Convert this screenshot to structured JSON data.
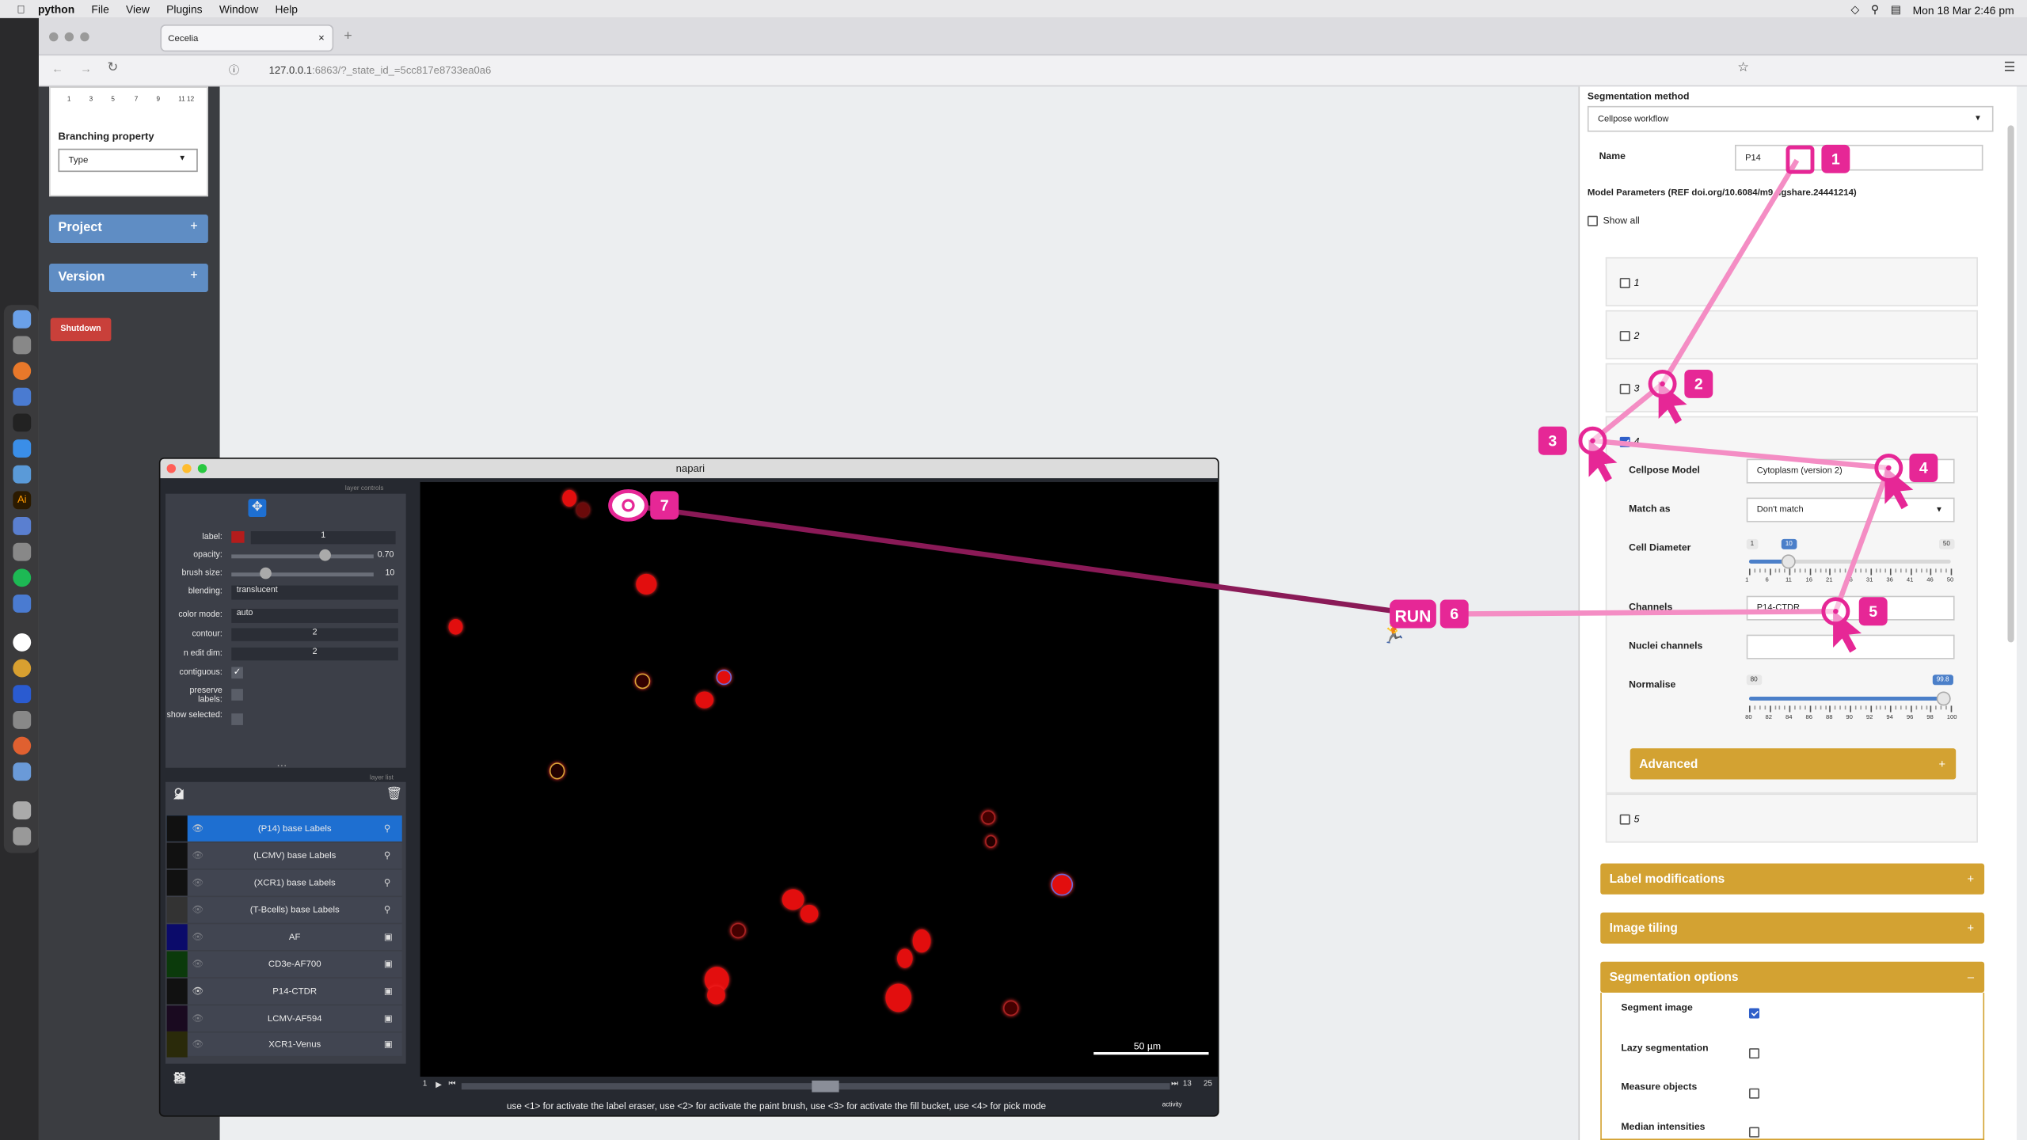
{
  "menubar": {
    "app": "python",
    "items": [
      "File",
      "View",
      "Plugins",
      "Window",
      "Help"
    ],
    "clock": "Mon 18 Mar  2:46 pm"
  },
  "browser": {
    "tab_title": "Cecelia",
    "url_host": "127.0.0.1",
    "url_rest": ":6863/?_state_id_=5cc817e8733ea0a6"
  },
  "sidebar": {
    "ruler_ticks": [
      "1",
      "3",
      "5",
      "7",
      "9",
      "11 12"
    ],
    "branching_label": "Branching property",
    "branching_value": "Type",
    "project": "Project",
    "version": "Version",
    "plus": "+",
    "shutdown": "Shutdown"
  },
  "panel": {
    "seg_method_label": "Segmentation method",
    "seg_method_value": "Cellpose workflow",
    "name_label": "Name",
    "name_value": "P14",
    "model_params": "Model Parameters (REF doi.org/10.6084/m9.figshare.24441214)",
    "show_all": "Show all",
    "items": [
      "1",
      "2",
      "3",
      "4",
      "5"
    ],
    "cellpose_model_label": "Cellpose Model",
    "cellpose_model_value": "Cytoplasm (version 2)",
    "match_as_label": "Match as",
    "match_as_value": "Don't match",
    "cell_diam_label": "Cell Diameter",
    "cell_diam_min": "1",
    "cell_diam_value": "10",
    "cell_diam_max": "50",
    "cell_diam_ticks": [
      "1",
      "6",
      "11",
      "16",
      "21",
      "26",
      "31",
      "36",
      "41",
      "46",
      "50"
    ],
    "channels_label": "Channels",
    "channels_value": "P14-CTDR",
    "nuclei_label": "Nuclei channels",
    "nuclei_value": "",
    "normalise_label": "Normalise",
    "normalise_min": "80",
    "normalise_value": "99.8",
    "normalise_ticks": [
      "80",
      "82",
      "84",
      "86",
      "88",
      "90",
      "92",
      "94",
      "96",
      "98",
      "100"
    ],
    "advanced": "Advanced",
    "label_mods": "Label modifications",
    "image_tiling": "Image tiling",
    "seg_options": "Segmentation options",
    "seg_image": "Segment image",
    "lazy_seg": "Lazy segmentation",
    "measure": "Measure objects",
    "median": "Median intensities"
  },
  "napari": {
    "title": "napari",
    "layer_controls": "layer controls",
    "layer_list": "layer list",
    "label_lbl": "label:",
    "label_val": "1",
    "opacity_lbl": "opacity:",
    "opacity_val": "0.70",
    "brush_lbl": "brush size:",
    "brush_val": "10",
    "blending_lbl": "blending:",
    "blending_val": "translucent",
    "color_lbl": "color mode:",
    "color_val": "auto",
    "contour_lbl": "contour:",
    "contour_val": "2",
    "ndim_lbl": "n edit dim:",
    "ndim_val": "2",
    "contig_lbl": "contiguous:",
    "preserve_lbl": "preserve labels:",
    "showsel_lbl": "show selected:",
    "layers": [
      "(P14) base Labels",
      "(LCMV) base Labels",
      "(XCR1) base Labels",
      "(T-Bcells) base Labels",
      "AF",
      "CD3e-AF700",
      "P14-CTDR",
      "LCMV-AF594",
      "XCR1-Venus"
    ],
    "scalebar": "50 µm",
    "frame": "1",
    "slice_val": "13",
    "slice_max": "25",
    "status": "use <1> for activate the label eraser, use <2> for activate the paint brush, use <3> for activate the fill bucket, use <4> for pick mode",
    "activity": "activity"
  },
  "annotations": {
    "n1": "1",
    "n2": "2",
    "n3": "3",
    "n4": "4",
    "n5": "5",
    "n6": "6",
    "n7": "7",
    "run": "RUN"
  },
  "colors": {
    "accent": "#e62796",
    "gold": "#d3a232",
    "blue": "#5f8dc4",
    "shutdown": "#c9403a"
  }
}
